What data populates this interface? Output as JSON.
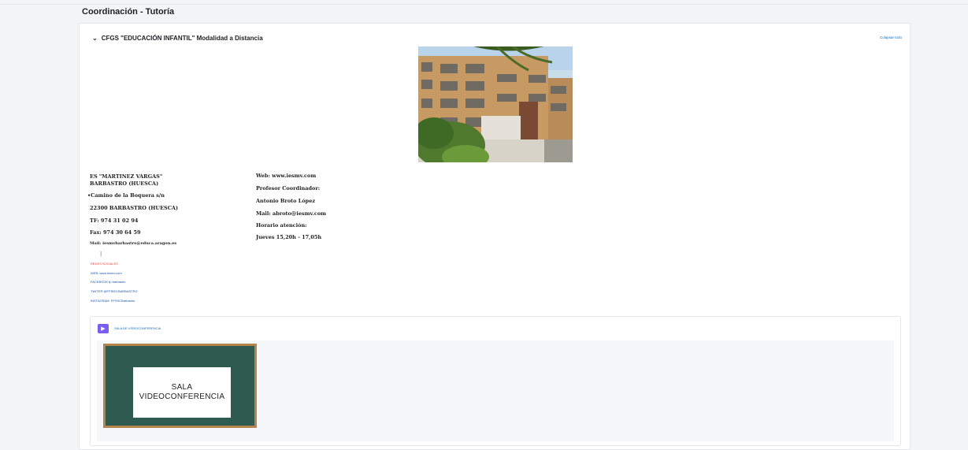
{
  "page": {
    "title": "Coordinación - Tutoría"
  },
  "section": {
    "title": "CFGS \"EDUCACIÓN INFANTIL\" Modalidad a Distancia",
    "collapse_all": "Colapsar todo"
  },
  "school": {
    "name_line1": "ES \"MARTINEZ VARGAS\"",
    "name_line2": "BARBASTRO (HUESCA)",
    "address": "Camino de la Boquera s/n",
    "city": "22300 BARBASTRO (HUESCA)",
    "phone": "TF: 974 31 02 94",
    "fax": "Fax: 974 30 64 59",
    "mail": "Mail: iesmvbarbastro@educa.aragon.es",
    "web": "Web: www.iesmv.com",
    "coordinator_label": "Profesor Coordinador:",
    "coordinator_name": "Antonio Broto López",
    "coordinator_mail": "Mail: abroto@iesmv.com",
    "schedule_label": "Horario atención:",
    "schedule": "Jueves 15,20h - 17,05h"
  },
  "social": {
    "heading": "REDES SOCIALES",
    "web": "WEB: www.iesmv.com",
    "facebook": "FACEBOOK fp.barbastro",
    "twitter": "TWITER @FPSIECBARBASTRO",
    "instagram": "INSTAGRAM: FPSSCBarbastro"
  },
  "activity": {
    "name": "SALA DE VIDEOCONFERENCIA",
    "icon": "video-play-icon",
    "board_line1": "SALA",
    "board_line2": "VIDEOCONFERENCIA"
  },
  "colors": {
    "link": "#0f6cbf",
    "red": "#e0403a",
    "activity_icon": "#7b5cf5"
  }
}
